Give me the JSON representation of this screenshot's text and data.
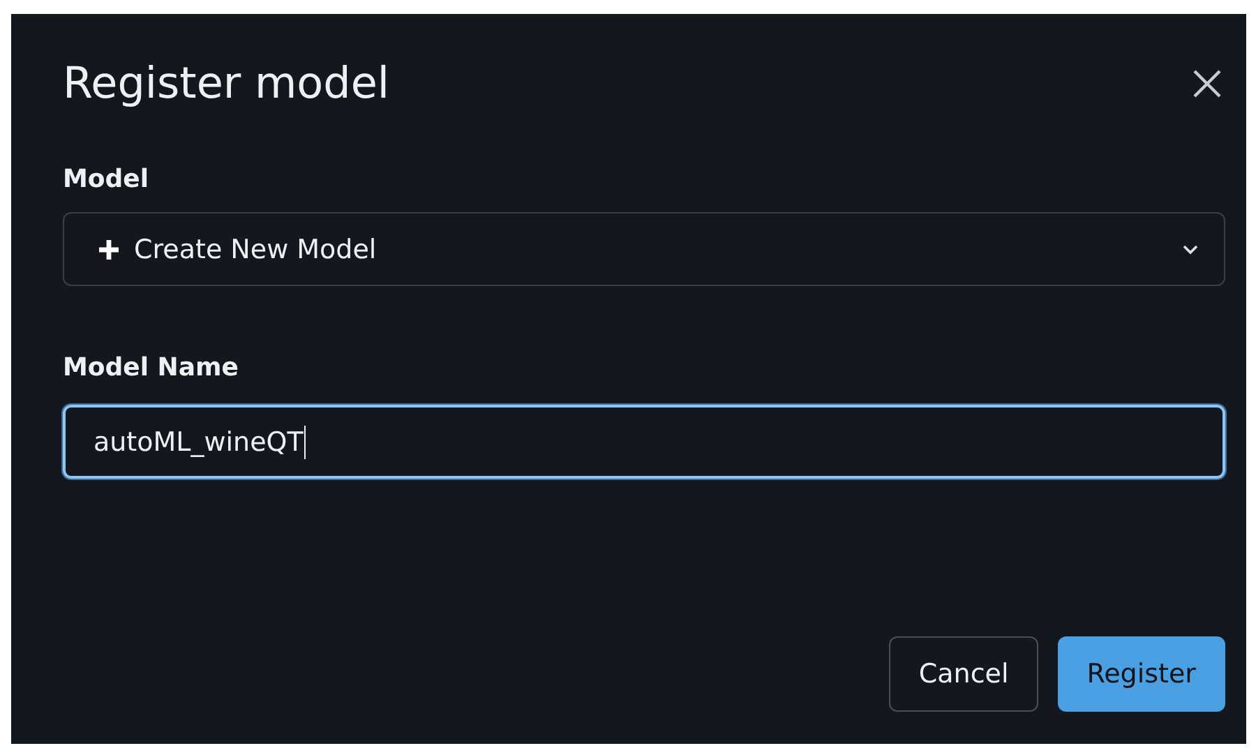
{
  "dialog": {
    "title": "Register model",
    "model_select": {
      "label": "Model",
      "value": "Create New Model"
    },
    "model_name": {
      "label": "Model Name",
      "value": "autoML_wineQT",
      "focused": true
    },
    "buttons": [
      {
        "label": "Cancel",
        "kind": "secondary"
      },
      {
        "label": "Register",
        "kind": "primary"
      }
    ]
  }
}
